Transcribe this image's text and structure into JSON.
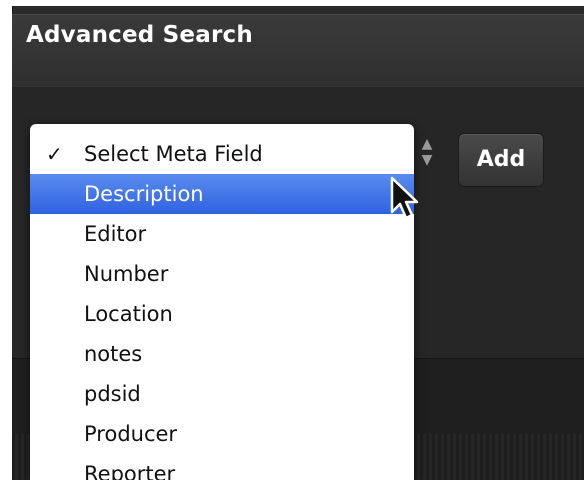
{
  "panel": {
    "title": "Advanced Search"
  },
  "controls": {
    "add_label": "Add",
    "stepper_up": "▲",
    "stepper_down": "▼"
  },
  "dropdown": {
    "checkmark": "✓",
    "items": [
      {
        "label": "Select Meta Field",
        "checked": true,
        "highlighted": false
      },
      {
        "label": "Description",
        "checked": false,
        "highlighted": true
      },
      {
        "label": "Editor",
        "checked": false,
        "highlighted": false
      },
      {
        "label": "Number",
        "checked": false,
        "highlighted": false
      },
      {
        "label": "Location",
        "checked": false,
        "highlighted": false
      },
      {
        "label": "notes",
        "checked": false,
        "highlighted": false
      },
      {
        "label": "pdsid",
        "checked": false,
        "highlighted": false
      },
      {
        "label": "Producer",
        "checked": false,
        "highlighted": false
      },
      {
        "label": "Reporter",
        "checked": false,
        "highlighted": false
      }
    ]
  },
  "colors": {
    "highlight_top": "#5a8cf0",
    "highlight_bottom": "#2f62e0",
    "panel_bg": "#2a2a2a",
    "title_text": "#ffffff"
  }
}
